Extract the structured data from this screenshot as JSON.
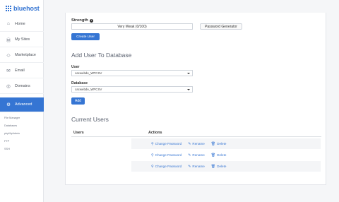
{
  "brand": {
    "name": "bluehost",
    "color": "#3575d3"
  },
  "sidebar": {
    "items": [
      {
        "label": "Home",
        "icon": "home-icon"
      },
      {
        "label": "My Sites",
        "icon": "wordpress-icon"
      },
      {
        "label": "Marketplace",
        "icon": "tag-icon"
      },
      {
        "label": "Email",
        "icon": "mail-icon"
      },
      {
        "label": "Domains",
        "icon": "globe-icon"
      },
      {
        "label": "Advanced",
        "icon": "gear-icon",
        "active": true
      }
    ],
    "subitems": [
      "File Manager",
      "Databases",
      "phpMyAdmin",
      "FTP",
      "SSH"
    ]
  },
  "create_user": {
    "strength_label": "Strength",
    "strength_value": "Very Weak (0/100)",
    "generator_label": "Password Generator",
    "create_button": "Create User"
  },
  "add_user": {
    "title": "Add User To Database",
    "user_label": "User",
    "user_value": "cacwebde_WPCSV",
    "database_label": "Database",
    "database_value": "cacwebde_WPCSV",
    "add_button": "Add"
  },
  "current_users": {
    "title": "Current Users",
    "columns": [
      "Users",
      "Actions"
    ],
    "actions": [
      "Change Password",
      "Rename",
      "Delete"
    ],
    "row_count": 3
  }
}
